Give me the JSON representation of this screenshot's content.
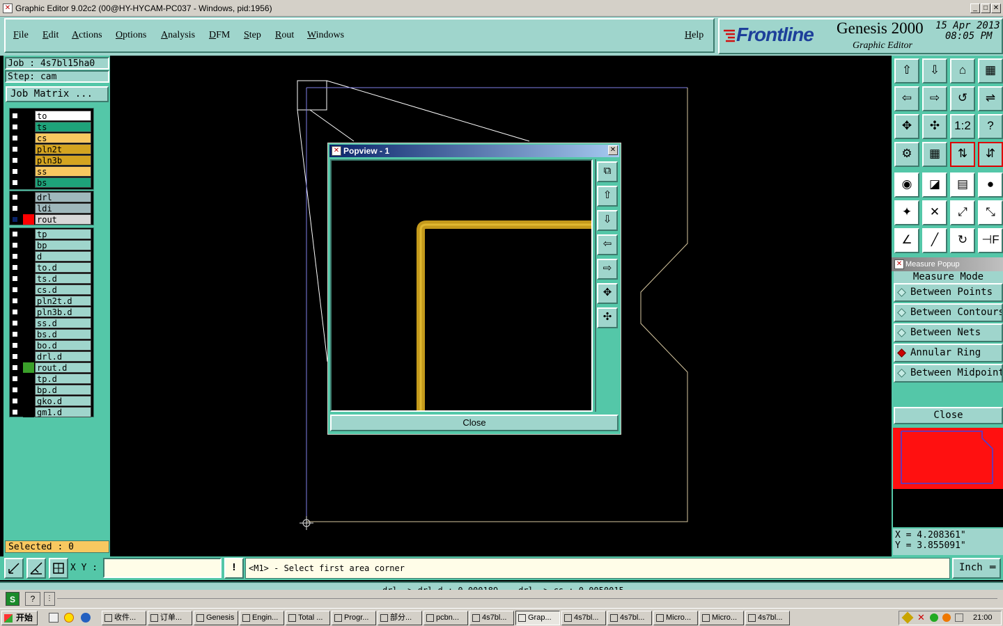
{
  "window": {
    "title": "Graphic Editor 9.02c2 (00@HY-HYCAM-PC037 - Windows, pid:1956)"
  },
  "menu": {
    "items": [
      "File",
      "Edit",
      "Actions",
      "Options",
      "Analysis",
      "DFM",
      "Step",
      "Rout",
      "Windows"
    ],
    "help": "Help"
  },
  "brand": {
    "logo": "Frontline",
    "product": "Genesis 2000",
    "subtitle": "Graphic Editor",
    "date": "15 Apr 2013",
    "time": "08:05 PM"
  },
  "job": {
    "job_label": "Job : 4s7bl15ha0",
    "step_label": "Step: cam",
    "matrix_button": "Job Matrix ..."
  },
  "layers": {
    "group1": [
      {
        "name": "to",
        "color": "#ffffff"
      },
      {
        "name": "ts",
        "color": "#1ea37a"
      },
      {
        "name": "cs",
        "color": "#f8c860"
      },
      {
        "name": "pln2t",
        "color": "#d4a420"
      },
      {
        "name": "pln3b",
        "color": "#d4a420"
      },
      {
        "name": "ss",
        "color": "#f8c860"
      },
      {
        "name": "bs",
        "color": "#1ea37a"
      }
    ],
    "group2": [
      {
        "name": "drl",
        "color": "#9fb8bc"
      },
      {
        "name": "ldi",
        "color": "#9fb8bc"
      },
      {
        "name": "rout",
        "color": "#d8d8d8"
      }
    ],
    "group3": [
      {
        "name": "tp"
      },
      {
        "name": "bp"
      },
      {
        "name": "d"
      },
      {
        "name": "to.d"
      },
      {
        "name": "ts.d"
      },
      {
        "name": "cs.d"
      },
      {
        "name": "pln2t.d"
      },
      {
        "name": "pln3b.d"
      },
      {
        "name": "ss.d"
      },
      {
        "name": "bs.d"
      },
      {
        "name": "bo.d"
      },
      {
        "name": "drl.d"
      },
      {
        "name": "rout.d"
      },
      {
        "name": "tp.d"
      },
      {
        "name": "bp.d"
      },
      {
        "name": "gko.d"
      },
      {
        "name": "gm1.d"
      }
    ]
  },
  "selected": "Selected : 0",
  "popview": {
    "title": "Popview - 1",
    "close": "Close"
  },
  "measure": {
    "title": "Measure Popup",
    "mode_label": "Measure Mode",
    "options": [
      "Between Points",
      "Between Contours",
      "Between Nets",
      "Annular Ring",
      "Between Midpoints"
    ],
    "selected": "Annular Ring",
    "close": "Close"
  },
  "coords": {
    "x": "X = 4.208361\"",
    "y": "Y = 3.855091\""
  },
  "command": {
    "xy_label": "X Y :",
    "xy_value": "",
    "prompt": "<M1> - Select first area corner",
    "units": "Inch"
  },
  "status": {
    "message": "drl -> drl.d : 0.000189    drl -> cs : 0.0050015"
  },
  "taskbar": {
    "start": "开始",
    "clock": "21:00",
    "tasks": [
      "收件...",
      "订单...",
      "Genesis",
      "Engin...",
      "Total ...",
      "Progr...",
      "部分...",
      "pcbn...",
      "4s7bl...",
      "Grap...",
      "4s7bl...",
      "4s7bl...",
      "Micro...",
      "Micro...",
      "4s7bl..."
    ],
    "active": "Grap..."
  }
}
